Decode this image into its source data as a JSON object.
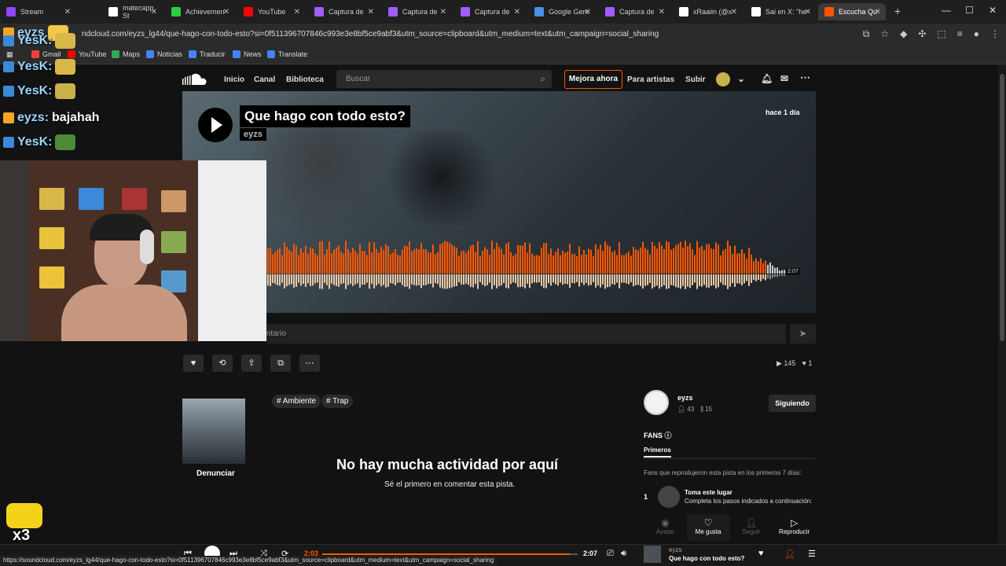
{
  "browser": {
    "tabs": [
      {
        "label": "Stream",
        "color": "#9146ff"
      },
      {
        "label": "matecapp St",
        "color": "#ffffff"
      },
      {
        "label": "Achievemen",
        "color": "#2ecc40"
      },
      {
        "label": "YouTube",
        "color": "#ff0000"
      },
      {
        "label": "Captura de",
        "color": "#a35cff"
      },
      {
        "label": "Captura de",
        "color": "#a35cff"
      },
      {
        "label": "Captura de",
        "color": "#a35cff"
      },
      {
        "label": "Google Gem",
        "color": "#4a90e2"
      },
      {
        "label": "Captura de",
        "color": "#a35cff"
      },
      {
        "label": "xRaaiin (@x",
        "color": "#ffffff"
      },
      {
        "label": "Sai en X: \"he",
        "color": "#ffffff"
      },
      {
        "label": "Escucha Qu",
        "color": "#ff5500"
      }
    ],
    "address": "ndcloud.com/eyzs_lg44/que-hago-con-todo-esto?si=0f511396707846c993e3e8bf5ce9abf3&utm_source=clipboard&utm_medium=text&utm_campaign=social_sharing",
    "bookmarks": [
      "Gmail",
      "YouTube",
      "Maps",
      "Noticias",
      "Traducir",
      "News",
      "Translate"
    ],
    "status_url": "https://soundcloud.com/eyzs_lg44/que-hago-con-todo-esto?si=0f511396707846c993e3e8bf5ce9abf3&utm_source=clipboard&utm_medium=text&utm_campaign=social_sharing"
  },
  "chat": [
    {
      "name": "eyzs",
      "message": ""
    },
    {
      "name": "YesK:",
      "message": ""
    },
    {
      "name": "YesK:",
      "message": ""
    },
    {
      "name": "YesK:",
      "message": ""
    },
    {
      "name": "eyzs:",
      "message": "bajahah"
    },
    {
      "name": "YesK:",
      "message": ""
    }
  ],
  "sticker_label": "x3",
  "nav": {
    "inicio": "Inicio",
    "canal": "Canal",
    "biblioteca": "Biblioteca",
    "search_placeholder": "Buscar",
    "mejora": "Mejora ahora",
    "para_artistas": "Para artistas",
    "subir": "Subir"
  },
  "track": {
    "title": "Que hago con todo esto?",
    "artist": "eyzs",
    "posted": "hace 1 día",
    "duration": "2:07",
    "plays": "145",
    "likes": "1",
    "progress": 0.96
  },
  "comment": {
    "placeholder": "ntario"
  },
  "tags": [
    "# Ambiente",
    "# Trap"
  ],
  "report": "Denunciar",
  "empty": {
    "title": "No hay mucha actividad por aquí",
    "subtitle": "Sé el primero en comentar esta pista."
  },
  "artist_side": {
    "name": "eyzs",
    "followers": "43",
    "tracks": "15",
    "following_label": "Siguiendo"
  },
  "fans": {
    "title": "FANS",
    "tab": "Primeros",
    "description": "Fans que reprodujeron esta pista en los primeros 7 días:",
    "rank": "1",
    "slot_title": "Toma este lugar",
    "slot_sub": "Completa los pasos indicados a continuación:",
    "actions": [
      "Avatar",
      "Me gusta",
      "Seguir",
      "Reproducir"
    ]
  },
  "player": {
    "current": "2:03",
    "total": "2:07",
    "progress": 0.968,
    "artist": "eyzs",
    "title": "Que hago con todo esto?"
  }
}
